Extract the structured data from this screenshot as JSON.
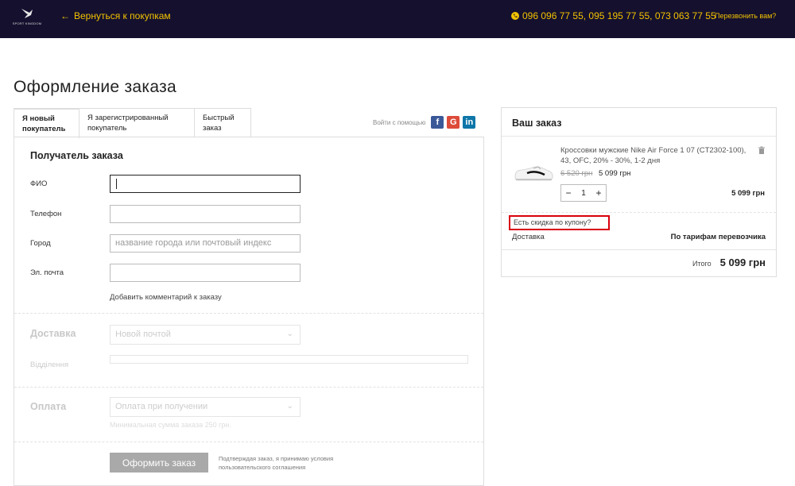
{
  "header": {
    "logo_text": "SPORT KINGDOM",
    "back_label": "Вернуться к покупкам",
    "phones": "096 096 77 55,  095 195 77 55,  073 063 77 55",
    "callback_label": "Перезвонить вам?",
    "accent_color": "#f2c200",
    "background_color": "#14102e"
  },
  "page_title": "Оформление заказа",
  "tabs": [
    {
      "label": "Я новый покупатель",
      "active": true
    },
    {
      "label": "Я зарегистрированный покупатель",
      "active": false
    },
    {
      "label": "Быстрый заказ",
      "active": false
    }
  ],
  "social": {
    "label": "Войти с помощью",
    "icons": [
      "facebook-icon",
      "google-icon",
      "linkedin-icon"
    ]
  },
  "recipient": {
    "title": "Получатель заказа",
    "fields": [
      {
        "label": "ФИО",
        "value": "",
        "placeholder": "",
        "focused": true
      },
      {
        "label": "Телефон",
        "value": "",
        "placeholder": ""
      },
      {
        "label": "Город",
        "value": "",
        "placeholder": "название города или почтовый индекс"
      },
      {
        "label": "Эл. почта",
        "value": "",
        "placeholder": ""
      }
    ],
    "comment_link": "Добавить комментарий к заказу"
  },
  "delivery": {
    "title": "Доставка",
    "method": "Новой почтой",
    "branch_label": "Відділення"
  },
  "payment": {
    "title": "Оплата",
    "method": "Оплата при получении",
    "min_note": "Минимальная сумма заказа 250 грн."
  },
  "submit": {
    "label": "Оформить заказ",
    "terms_text": "Подтверждая заказ, я принимаю условия",
    "terms_link": "пользовательского соглашения"
  },
  "order": {
    "title": "Ваш заказ",
    "item": {
      "name": "Кроссовки мужские Nike Air Force 1 07 (CT2302-100), 43, OFC, 20% - 30%, 1-2 дня",
      "old_price": "6 520 грн",
      "price": "5 099 грн",
      "quantity": "1",
      "total": "5 099 грн"
    },
    "coupon_label": "Есть скидка по купону?",
    "shipping_label": "Доставка",
    "shipping_value": "По тарифам перевозчика",
    "total_label": "Итого",
    "total_value": "5 099 грн"
  }
}
